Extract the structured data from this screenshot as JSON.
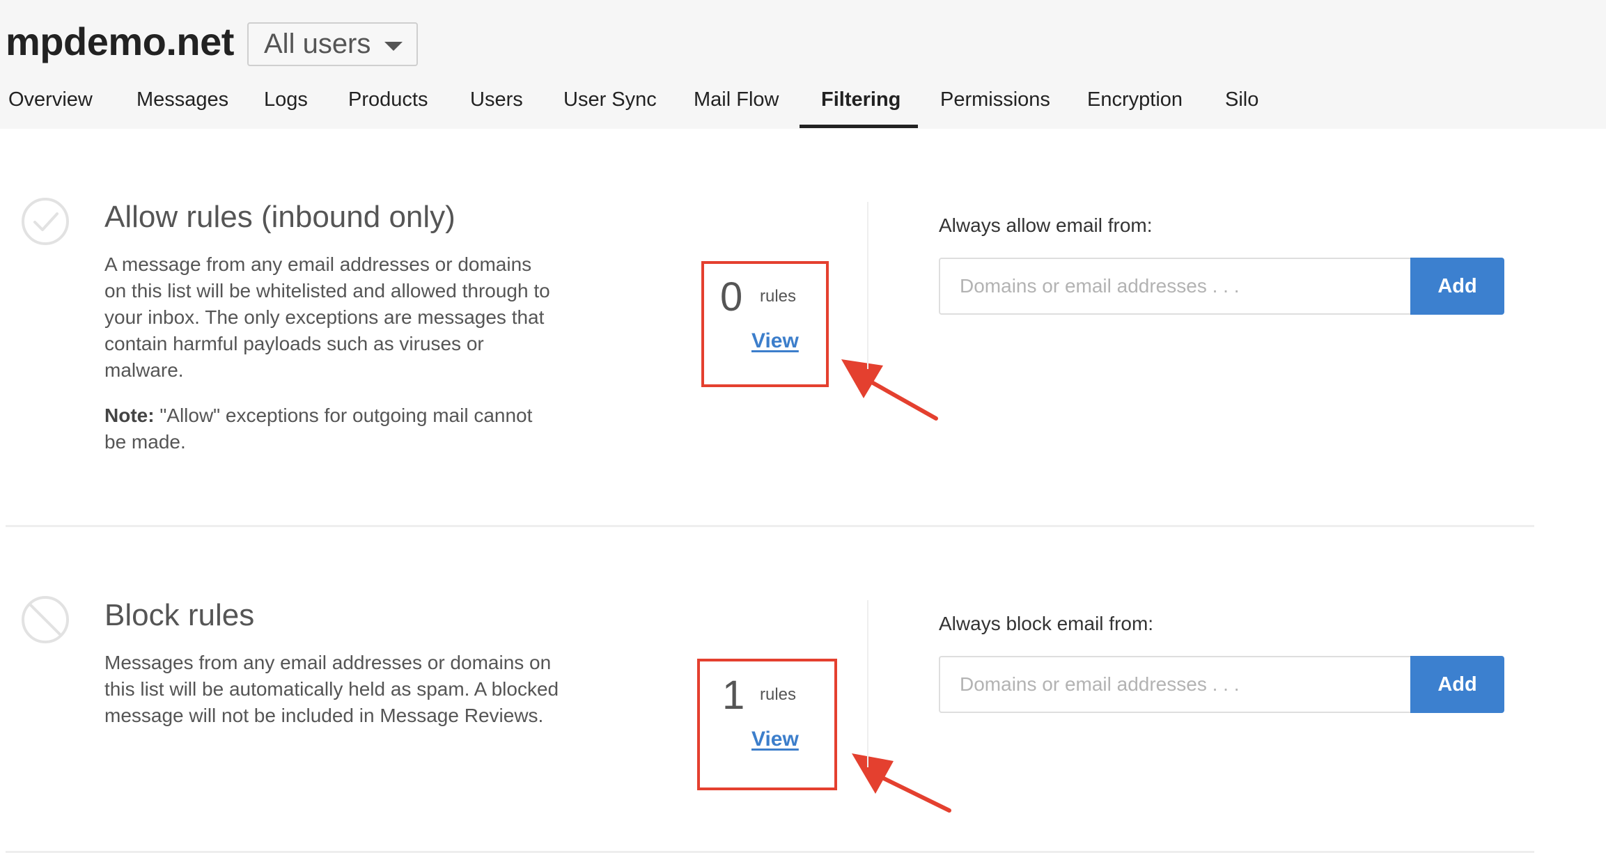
{
  "header": {
    "domain_name": "mpdemo.net",
    "user_filter": {
      "selected": "All users"
    }
  },
  "tabs": [
    {
      "label": "Overview",
      "active": false
    },
    {
      "label": "Messages",
      "active": false
    },
    {
      "label": "Logs",
      "active": false
    },
    {
      "label": "Products",
      "active": false
    },
    {
      "label": "Users",
      "active": false
    },
    {
      "label": "User Sync",
      "active": false
    },
    {
      "label": "Mail Flow",
      "active": false
    },
    {
      "label": "Filtering",
      "active": true
    },
    {
      "label": "Permissions",
      "active": false
    },
    {
      "label": "Encryption",
      "active": false
    },
    {
      "label": "Silo",
      "active": false
    }
  ],
  "allow": {
    "icon": "check-circle-icon",
    "title": "Allow rules (inbound only)",
    "description": "A message from any email addresses or domains on this list will be whitelisted and allowed through to your inbox. The only exceptions are messages that contain harmful payloads such as viruses or malware.",
    "note_label": "Note:",
    "note_text": " \"Allow\" exceptions for outgoing mail cannot be made.",
    "count": "0",
    "count_unit": "rules",
    "view_label": "View",
    "field_label": "Always allow email from:",
    "input_placeholder": "Domains or email addresses . . .",
    "input_value": "",
    "add_label": "Add"
  },
  "block": {
    "icon": "block-circle-icon",
    "title": "Block rules",
    "description": "Messages from any email addresses or domains on this list will be automatically held as spam. A blocked message will not be included in Message Reviews.",
    "count": "1",
    "count_unit": "rules",
    "view_label": "View",
    "field_label": "Always block email from:",
    "input_placeholder": "Domains or email addresses . . .",
    "input_value": "",
    "add_label": "Add"
  },
  "colors": {
    "accent": "#3c80cf",
    "link": "#3c7ecb",
    "highlight": "#e4402f"
  }
}
